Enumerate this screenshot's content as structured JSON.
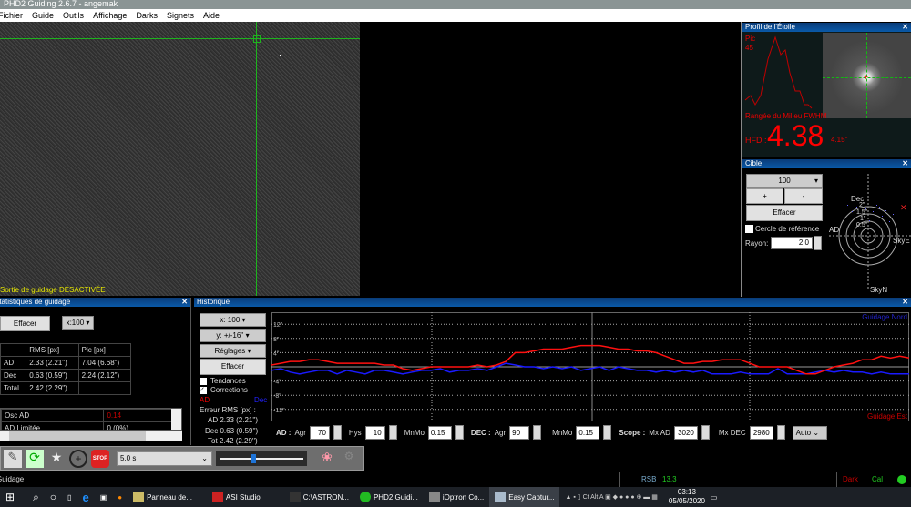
{
  "window": {
    "title": "PHD2 Guiding 2.6.7 - angemak"
  },
  "menu": [
    "Fichier",
    "Guide",
    "Outils",
    "Affichage",
    "Darks",
    "Signets",
    "Aide"
  ],
  "camera": {
    "status": "Sortie de guidage DÉSACTIVÉE"
  },
  "profile": {
    "title": "Profil de l'Étoile",
    "peak_label": "Pic",
    "peak_value": "45",
    "row_label": "Rangée du Milieu FWHM",
    "hfd_label": "HFD :",
    "hfd_value": "4.38",
    "hfd_arcsec": "4.15\""
  },
  "target": {
    "title": "Cible",
    "zoom": "100",
    "plus": "+",
    "minus": "-",
    "clear": "Effacer",
    "ref_circle": "Cercle de référence",
    "ref_checked": false,
    "radius_label": "Rayon:",
    "radius_value": "2.0",
    "labels": {
      "dec": "Dec",
      "ad": "AD",
      "skye": "SkyE",
      "skyn": "SkyN",
      "r2": "2\"",
      "r15": "1.5\"",
      "r1": "1\"",
      "r05": "0.5\""
    }
  },
  "stats": {
    "title": "Statistiques de guidage",
    "clear": "Effacer",
    "scale": "x:100",
    "headers": [
      "",
      "RMS [px]",
      "Pic [px]"
    ],
    "rows": [
      [
        "AD",
        "2.33 (2.21\")",
        "7.04 (6.68\")"
      ],
      [
        "Dec",
        "0.63 (0.59\")",
        "2.24 (2.12\")"
      ],
      [
        "Total",
        "2.42 (2.29\")",
        ""
      ]
    ],
    "extra": [
      [
        "Osc AD",
        "0.14"
      ],
      [
        "AD Limitée",
        "0 (0%)"
      ]
    ]
  },
  "history": {
    "title": "Historique",
    "x_scale": "x: 100",
    "y_scale": "y: +/-16''",
    "settings": "Réglages",
    "clear": "Effacer",
    "trends": "Tendances",
    "trends_checked": false,
    "corrections": "Corrections",
    "corrections_checked": true,
    "ad_label": "AD",
    "dec_label": "Dec",
    "rms_title": "Erreur RMS [px] :",
    "rms_ad": "AD 2.33 (2.21'')",
    "rms_dec": "Dec 0.63 (0.59'')",
    "rms_tot": "Tot 2.42 (2.29'')",
    "y_ticks": [
      "12\"",
      "8\"",
      "4\"",
      "-4\"",
      "-8\"",
      "-12\""
    ],
    "north_label": "Guidage Nord",
    "east_label": "Guidage Est",
    "colors": {
      "ra": "#ff1010",
      "dec": "#1a1aff"
    },
    "ra_series": [
      0.5,
      1,
      1.5,
      1.5,
      2,
      2,
      1.5,
      1,
      1,
      1,
      1,
      1,
      0.5,
      0.5,
      -0.5,
      -1,
      -0.5,
      0,
      0,
      0,
      0,
      0,
      0.5,
      0,
      0.5,
      1.5,
      4,
      4,
      4.5,
      5,
      5,
      5,
      5.5,
      6,
      6,
      6,
      5.5,
      5,
      5,
      4.5,
      4.5,
      4,
      3,
      2,
      1,
      1,
      1.5,
      1.5,
      2,
      2,
      2,
      1,
      0,
      0,
      0,
      0,
      -1,
      -2,
      -2,
      -1,
      0,
      0.5,
      1,
      2,
      2,
      3,
      2.5,
      3,
      2.5
    ],
    "dec_series": [
      -1,
      -0.5,
      -1.5,
      -2,
      -1.5,
      -1,
      -1,
      -2,
      -1,
      -1.5,
      -2,
      -1,
      -1,
      -1.5,
      -2,
      -1.5,
      -1,
      -1,
      -0.5,
      -1.5,
      -1,
      -1,
      -0.5,
      -1,
      0,
      1,
      0.5,
      0,
      0,
      -0.5,
      0,
      -0.5,
      0,
      -1,
      -0.5,
      0,
      -1,
      0,
      -0.5,
      -1,
      -1,
      -1.5,
      -1,
      -1.5,
      -1,
      -1.5,
      -1,
      -2,
      -2,
      -2,
      -1.5,
      -2,
      -2,
      -2,
      -0.5,
      -2,
      -2,
      -2,
      -1.5,
      -1,
      -1.5,
      -1,
      -1.5,
      -1.5,
      -2,
      -1.5,
      -2,
      -2,
      -2
    ]
  },
  "controls": {
    "ad_label": "AD :",
    "agr": "Agr",
    "ad_agr": "70",
    "hys": "Hys",
    "ad_hys": "10",
    "mnmo": "MnMo",
    "ad_mnmo": "0.15",
    "dec_label": "DEC :",
    "dec_agr": "90",
    "dec_mnmo": "0.15",
    "scope_label": "Scope :",
    "mx_ad": "Mx AD",
    "mx_ad_val": "3020",
    "mx_dec": "Mx DEC",
    "mx_dec_val": "2980",
    "mode": "Auto"
  },
  "toolbar": {
    "exposure": "5.0 s",
    "exposure_slider": 0.4,
    "stop": "STOP"
  },
  "status": {
    "text": "Guidage",
    "snr_label": "RSB",
    "snr_value": "13.3",
    "dark": "Dark",
    "cal": "Cal"
  },
  "taskbar": {
    "apps": [
      "Panneau de...",
      "ASI Studio",
      "C:\\ASTRON...",
      "PHD2 Guidi...",
      "iOptron Co...",
      "Easy Captur..."
    ],
    "time": "03:13",
    "date": "05/05/2020"
  }
}
